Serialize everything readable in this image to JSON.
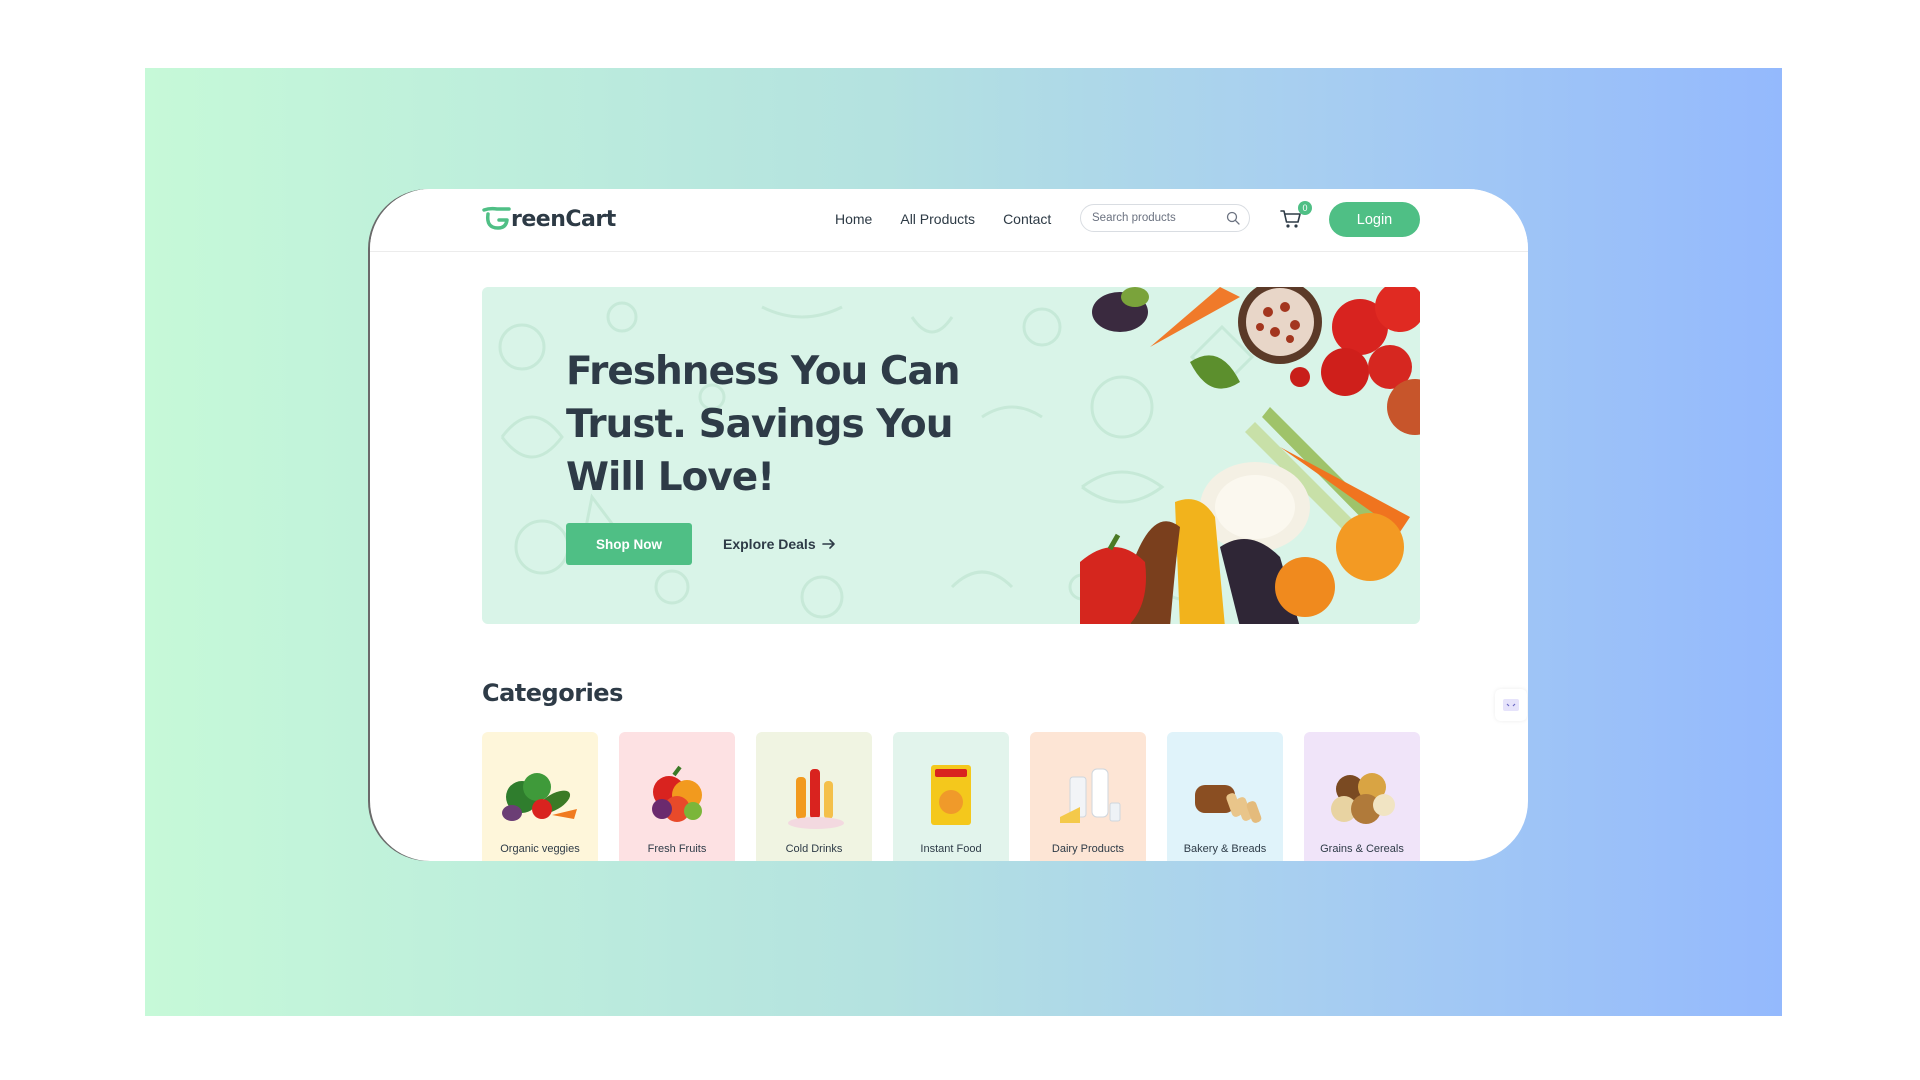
{
  "brand": {
    "name": "reenCart",
    "accent": "#4fbf85"
  },
  "nav": {
    "links": [
      "Home",
      "All Products",
      "Contact"
    ],
    "search_placeholder": "Search products",
    "cart_count": "0",
    "login_label": "Login"
  },
  "hero": {
    "title": "Freshness You Can Trust. Savings You Will Love!",
    "primary_button": "Shop Now",
    "secondary_link": "Explore Deals"
  },
  "categories": {
    "title": "Categories",
    "items": [
      {
        "label": "Organic veggies",
        "bg": "#fef6da"
      },
      {
        "label": "Fresh Fruits",
        "bg": "#fde1e3"
      },
      {
        "label": "Cold Drinks",
        "bg": "#f0f4e2"
      },
      {
        "label": "Instant Food",
        "bg": "#e2f4ec"
      },
      {
        "label": "Dairy Products",
        "bg": "#fde5d5"
      },
      {
        "label": "Bakery & Breads",
        "bg": "#e0f3fa"
      },
      {
        "label": "Grains & Cereals",
        "bg": "#f0e4f9"
      }
    ]
  }
}
